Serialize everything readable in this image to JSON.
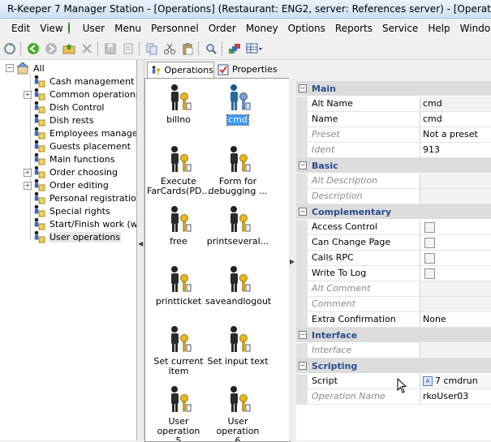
{
  "window": {
    "title": "R-Keeper 7 Manager Station - [Operations] (Restaurant: ENG2, server: References server) - [Operations]"
  },
  "menu": [
    "Edit",
    "View",
    "User",
    "Menu",
    "Personnel",
    "Order",
    "Money",
    "Options",
    "Reports",
    "Service",
    "Help",
    "Window"
  ],
  "tree": {
    "root": "All",
    "items": [
      "Cash management",
      "Common operations",
      "Dish Control",
      "Dish rests",
      "Employees manageme",
      "Guests placement",
      "Main functions",
      "Order choosing",
      "Order editing",
      "Personal registration",
      "Special rights",
      "Start/Finish work (writ",
      "User operations"
    ]
  },
  "tabs": {
    "operations": "Operations",
    "properties": "Properties"
  },
  "icons": [
    {
      "c1": "billno",
      "c2": ""
    },
    {
      "c1": "cmd",
      "c2": ""
    },
    {
      "c1": "Execute",
      "c2": "FarCards(PD..."
    },
    {
      "c1": "Form for",
      "c2": "debugging ..."
    },
    {
      "c1": "free",
      "c2": ""
    },
    {
      "c1": "printseveral...",
      "c2": ""
    },
    {
      "c1": "printticket",
      "c2": ""
    },
    {
      "c1": "saveandlogout",
      "c2": ""
    },
    {
      "c1": "Set current",
      "c2": "item"
    },
    {
      "c1": "Set input text",
      "c2": ""
    },
    {
      "c1": "User operation",
      "c2": "5"
    },
    {
      "c1": "User operation",
      "c2": "6"
    }
  ],
  "props": {
    "main": "Main",
    "alt_name_l": "Alt Name",
    "alt_name_v": "cmd",
    "name_l": "Name",
    "name_v": "cmd",
    "preset_l": "Preset",
    "preset_v": "Not a preset",
    "ident_l": "Ident",
    "ident_v": "913",
    "basic": "Basic",
    "alt_desc_l": "Alt Description",
    "desc_l": "Description",
    "complementary": "Complementary",
    "access_l": "Access Control",
    "change_l": "Can Change Page",
    "rpc_l": "Calls RPC",
    "log_l": "Write To Log",
    "alt_comment_l": "Alt Comment",
    "comment_l": "Comment",
    "extra_l": "Extra Confirmation",
    "extra_v": "None",
    "interface": "Interface",
    "interface_l": "Interface",
    "scripting": "Scripting",
    "script_l": "Script",
    "script_v": "7 cmdrun",
    "opname_l": "Operation Name",
    "opname_v": "rkoUser03"
  }
}
